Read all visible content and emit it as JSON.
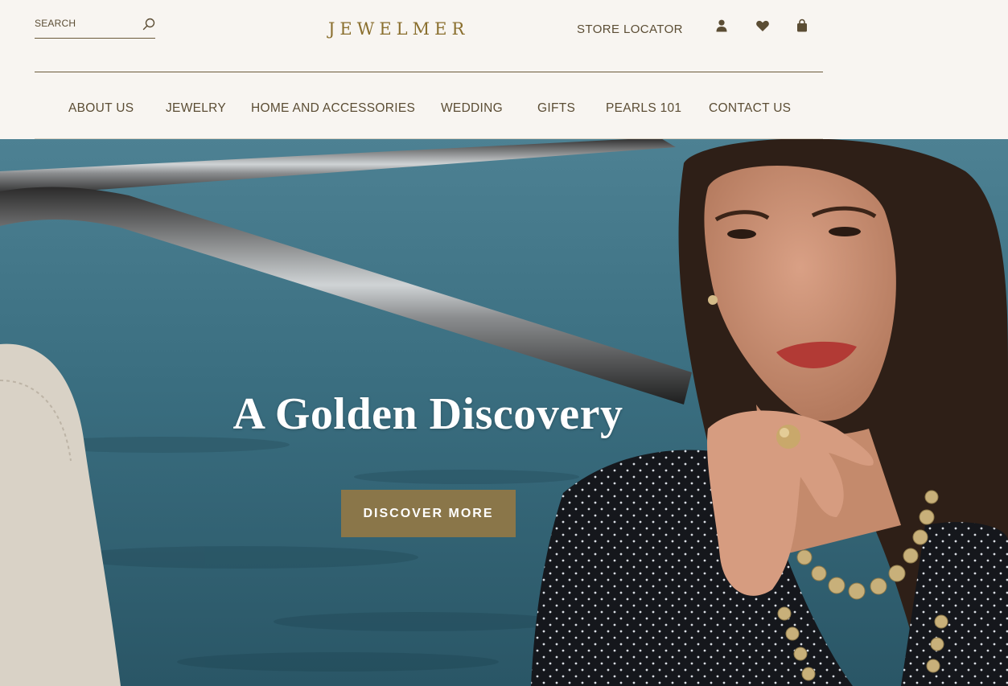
{
  "header": {
    "search": {
      "placeholder": "SEARCH",
      "value": "",
      "icon": "search-icon"
    },
    "logo": "JEWELMER",
    "store_locator_label": "STORE LOCATOR",
    "icons": [
      "account-icon",
      "heart-icon",
      "bag-icon"
    ]
  },
  "nav": {
    "items": [
      {
        "label": "ABOUT US"
      },
      {
        "label": "JEWELRY"
      },
      {
        "label": "HOME AND ACCESSORIES"
      },
      {
        "label": "WEDDING"
      },
      {
        "label": "GIFTS"
      },
      {
        "label": "PEARLS 101"
      },
      {
        "label": "CONTACT US"
      }
    ]
  },
  "hero": {
    "title": "A Golden Discovery",
    "cta_label": "DISCOVER MORE"
  },
  "colors": {
    "background": "#f8f5f1",
    "brand_gold": "#8a6f2e",
    "text_brown": "#5b4d34",
    "cta": "#8a7649"
  }
}
